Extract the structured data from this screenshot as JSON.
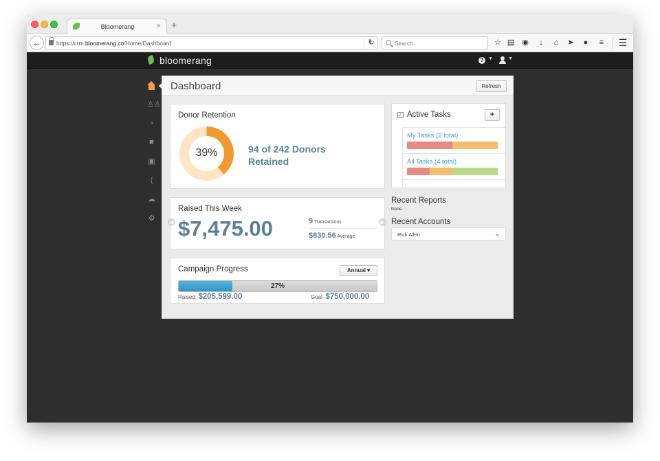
{
  "browser": {
    "tab_title": "Bloomerang",
    "tab_close": "×",
    "new_tab": "+",
    "url_prefix": "https://crm.",
    "url_domain": "bloomerang.co",
    "url_path": "/Home/Dashboard",
    "search_placeholder": "Search",
    "toolbar_icons": [
      "star-icon",
      "clipboard-icon",
      "pocket-icon",
      "download-icon",
      "home-icon",
      "send-icon",
      "chat-icon",
      "layers-icon",
      "menu-icon"
    ]
  },
  "app": {
    "logo_text": "bloomerang",
    "brand_color": "#6abf4b",
    "accent_color": "#5a8098",
    "help_glyph": "?",
    "rail_icons": [
      "home-icon",
      "constituents-icon",
      "reports-icon",
      "documents-icon",
      "forms-icon",
      "share-icon",
      "cloud-icon",
      "settings-icon"
    ]
  },
  "dashboard": {
    "title": "Dashboard",
    "refresh_label": "Refresh",
    "donor_retention": {
      "title": "Donor Retention",
      "percent": 39,
      "percent_label": "39%",
      "retained_line1": "94 of 242 Donors",
      "retained_line2": "Retained"
    },
    "raised_this_week": {
      "title": "Raised This Week",
      "amount": "$7,475.00",
      "transactions_count": "9",
      "transactions_label": "Transactions",
      "average_value": "$830.56",
      "average_label": "Average"
    },
    "campaign_progress": {
      "title": "Campaign Progress",
      "period": "Annual",
      "percent": 27,
      "percent_label": "27%",
      "raised_label": "Raised",
      "raised_value": "$205,599.00",
      "goal_label": "Goal",
      "goal_value": "$750,000.00"
    },
    "active_tasks": {
      "title": "Active Tasks",
      "add_label": "+",
      "items": [
        {
          "label": "My Tasks (2 total)",
          "segments": [
            0.5,
            0.5,
            0
          ]
        },
        {
          "label": "All Tasks (4 total)",
          "segments": [
            0.25,
            0.25,
            0.5
          ]
        }
      ]
    },
    "recent_reports": {
      "title": "Recent Reports",
      "value": "None"
    },
    "recent_accounts": {
      "title": "Recent Accounts",
      "selected": "Rick Allen"
    }
  }
}
